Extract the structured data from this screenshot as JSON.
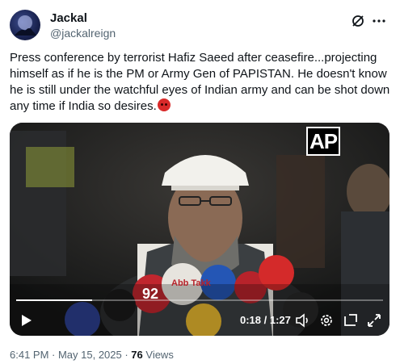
{
  "author": {
    "display_name": "Jackal",
    "handle": "@jackalreign"
  },
  "header_icons": [
    "grok-icon",
    "more-icon"
  ],
  "tweet": {
    "text": "Press conference by terrorist Hafiz Saeed after ceasefire...projecting himself as if he is the PM or Army Gen of PAPISTAN. He doesn't know he is still under the watchful eyes of Indian army and can be shot down any time if India so desires.",
    "emoji": "angry-face"
  },
  "video": {
    "watermark": "AP",
    "elapsed": "0:18",
    "separator": " / ",
    "duration": "1:27",
    "progress": 0.207,
    "controls": [
      "play-icon",
      "volume-icon",
      "settings-icon",
      "pip-icon",
      "fullscreen-icon"
    ],
    "mic_labels": [
      "92",
      "Abb Takk"
    ]
  },
  "meta": {
    "timestamp": "6:41 PM · May 15, 2025 · ",
    "views_count": "76",
    "views_label": " Views"
  },
  "colors": {
    "text": "#0f1419",
    "secondary": "#536471",
    "video_bg": "#1d1f20"
  }
}
